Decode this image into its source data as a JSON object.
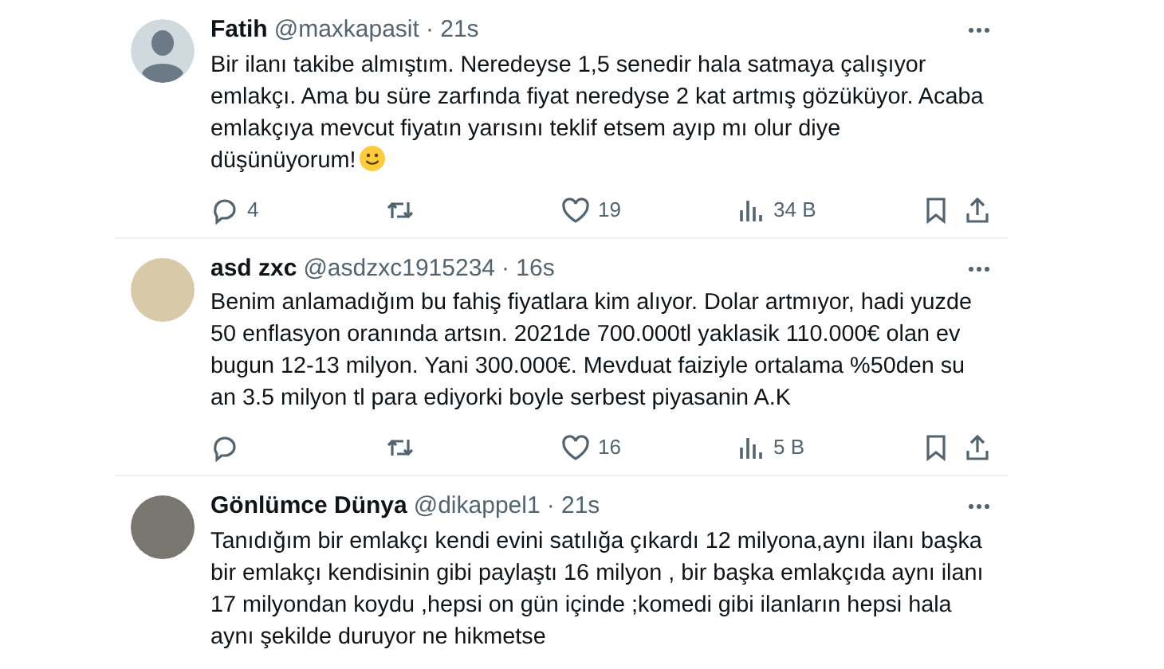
{
  "tweets": [
    {
      "name": "Fatih",
      "handle": "@maxkapasit",
      "time": "· 21s",
      "avatar": {
        "kind": "default"
      },
      "text": "Bir ilanı takibe almıştım. Neredeyse 1,5 senedir hala satmaya çalışıyor\nemlakçı. Ama bu süre zarfında fiyat neredyse 2 kat artmış gözüküyor. Acaba\nemlakçıya mevcut fiyatın yarısını teklif etsem ayıp mı olur diye\ndüşünüyorum!",
      "emoji": true,
      "actions": [
        {
          "kind": "reply",
          "count": "4"
        },
        {
          "kind": "retweet"
        },
        {
          "kind": "like",
          "count": "19"
        },
        {
          "kind": "views",
          "count": "34 B"
        }
      ]
    },
    {
      "name": "asd zxc",
      "handle": "@asdzxc1915234",
      "time": "· 16s",
      "avatar": {
        "kind": "plain"
      },
      "text": "Benim anlamadığım bu fahiş fiyatlara kim alıyor. Dolar artmıyor, hadi yuzde\n50 enflasyon oranında artsın. 2021de 700.000tl yaklasik 110.000€ olan ev\nbugun 12-13 milyon. Yani 300.000€. Mevduat faiziyle ortalama %50den su\nan 3.5 milyon tl para ediyorki boyle serbest piyasanin A.K",
      "emoji": false,
      "actions": [
        {
          "kind": "reply"
        },
        {
          "kind": "retweet"
        },
        {
          "kind": "like",
          "count": "16"
        },
        {
          "kind": "views",
          "count": "5 B"
        }
      ]
    },
    {
      "name": "Gönlümce Dünya",
      "handle": "@dikappel1",
      "time": "· 21s",
      "avatar": {
        "kind": "photo"
      },
      "text": "Tanıdığım bir emlakçı kendi evini satılığa çıkardı 12 milyona,aynı ilanı başka\nbir emlakçı kendisinin gibi paylaştı 16 milyon , bir başka emlakçıda aynı ilanı\n17 milyondan koydu ,hepsi on gün içinde ;komedi gibi ilanların hepsi hala\naynı şekilde duruyor ne hikmetse",
      "emoji": false
    }
  ]
}
